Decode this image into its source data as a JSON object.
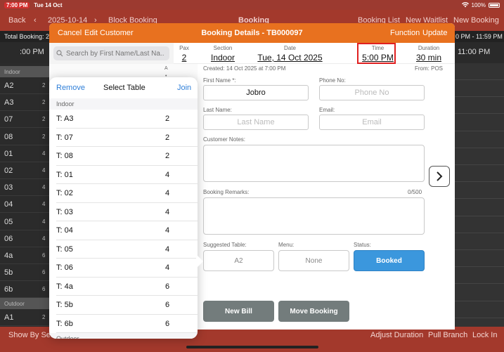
{
  "status_bar": {
    "time": "7:00 PM",
    "date": "Tue 14 Oct",
    "battery": "100%"
  },
  "background": {
    "back": "Back",
    "date": "2025-10-14",
    "block_booking": "Block Booking",
    "title": "Booking",
    "booking_list": "Booking List",
    "new_waitlist": "New Waitlist",
    "new_booking": "New Booking",
    "total_booking": "Total Booking: 2",
    "time_range": "0 PM - 11:59 PM",
    "time_left": ":00 PM",
    "time_right": "11:00 PM",
    "section_indoor": "Indoor",
    "section_outdoor": "Outdoor",
    "tables": [
      {
        "name": "A2",
        "cap": "2"
      },
      {
        "name": "A3",
        "cap": "2"
      },
      {
        "name": "07",
        "cap": "2"
      },
      {
        "name": "08",
        "cap": "2"
      },
      {
        "name": "01",
        "cap": "4"
      },
      {
        "name": "02",
        "cap": "4"
      },
      {
        "name": "03",
        "cap": "4"
      },
      {
        "name": "04",
        "cap": "4"
      },
      {
        "name": "05",
        "cap": "4"
      },
      {
        "name": "06",
        "cap": "4"
      },
      {
        "name": "4a",
        "cap": "6"
      },
      {
        "name": "5b",
        "cap": "6"
      },
      {
        "name": "6b",
        "cap": "6"
      }
    ],
    "outdoor_table": {
      "name": "A1",
      "cap": "2"
    },
    "show_by": "Show By Sea",
    "adjust_duration": "Adjust Duration",
    "pull_branch": "Pull Branch",
    "lock_in": "Lock In"
  },
  "modal": {
    "cancel": "Cancel",
    "edit_customer": "Edit Customer",
    "title": "Booking Details - TB000097",
    "function": "Function",
    "update": "Update",
    "search_placeholder": "Search by First Name/Last Na...",
    "info": {
      "pax_label": "Pax",
      "pax": "2",
      "section_label": "Section",
      "section": "Indoor",
      "date_label": "Date",
      "date": "Tue, 14 Oct 2025",
      "time_label": "Time",
      "time": "5:00 PM",
      "duration_label": "Duration",
      "duration": "30 min"
    },
    "created": "Created: 14 Oct 2025 at 7:00 PM",
    "from": "From: POS",
    "first_name_label": "First Name *:",
    "first_name": "Jobro",
    "phone_label": "Phone No:",
    "phone_placeholder": "Phone No",
    "last_name_label": "Last Name:",
    "last_name_placeholder": "Last Name",
    "email_label": "Email:",
    "email_placeholder": "Email",
    "customer_notes_label": "Customer Notes:",
    "booking_remarks_label": "Booking Remarks:",
    "remarks_count": "0/500",
    "suggested_table_label": "Suggested Table:",
    "suggested_table": "A2",
    "menu_label": "Menu:",
    "menu": "None",
    "status_label": "Status:",
    "status": "Booked",
    "new_bill": "New Bill",
    "move_booking": "Move Booking"
  },
  "popover": {
    "remove": "Remove",
    "title": "Select Table",
    "join": "Join",
    "section_indoor": "Indoor",
    "section_outdoor": "Outdoor",
    "rows": [
      {
        "table": "T: A3",
        "cap": "2"
      },
      {
        "table": "T: 07",
        "cap": "2"
      },
      {
        "table": "T: 08",
        "cap": "2"
      },
      {
        "table": "T: 01",
        "cap": "4"
      },
      {
        "table": "T: 02",
        "cap": "4"
      },
      {
        "table": "T: 03",
        "cap": "4"
      },
      {
        "table": "T: 04",
        "cap": "4"
      },
      {
        "table": "T: 05",
        "cap": "4"
      },
      {
        "table": "T: 06",
        "cap": "4"
      },
      {
        "table": "T: 4a",
        "cap": "6"
      },
      {
        "table": "T: 5b",
        "cap": "6"
      },
      {
        "table": "T: 6b",
        "cap": "6"
      }
    ]
  },
  "colors": {
    "header_orange": "#e8711f",
    "status_blue": "#3b97dd",
    "app_red": "#a3392c",
    "highlight": "#e02020"
  }
}
